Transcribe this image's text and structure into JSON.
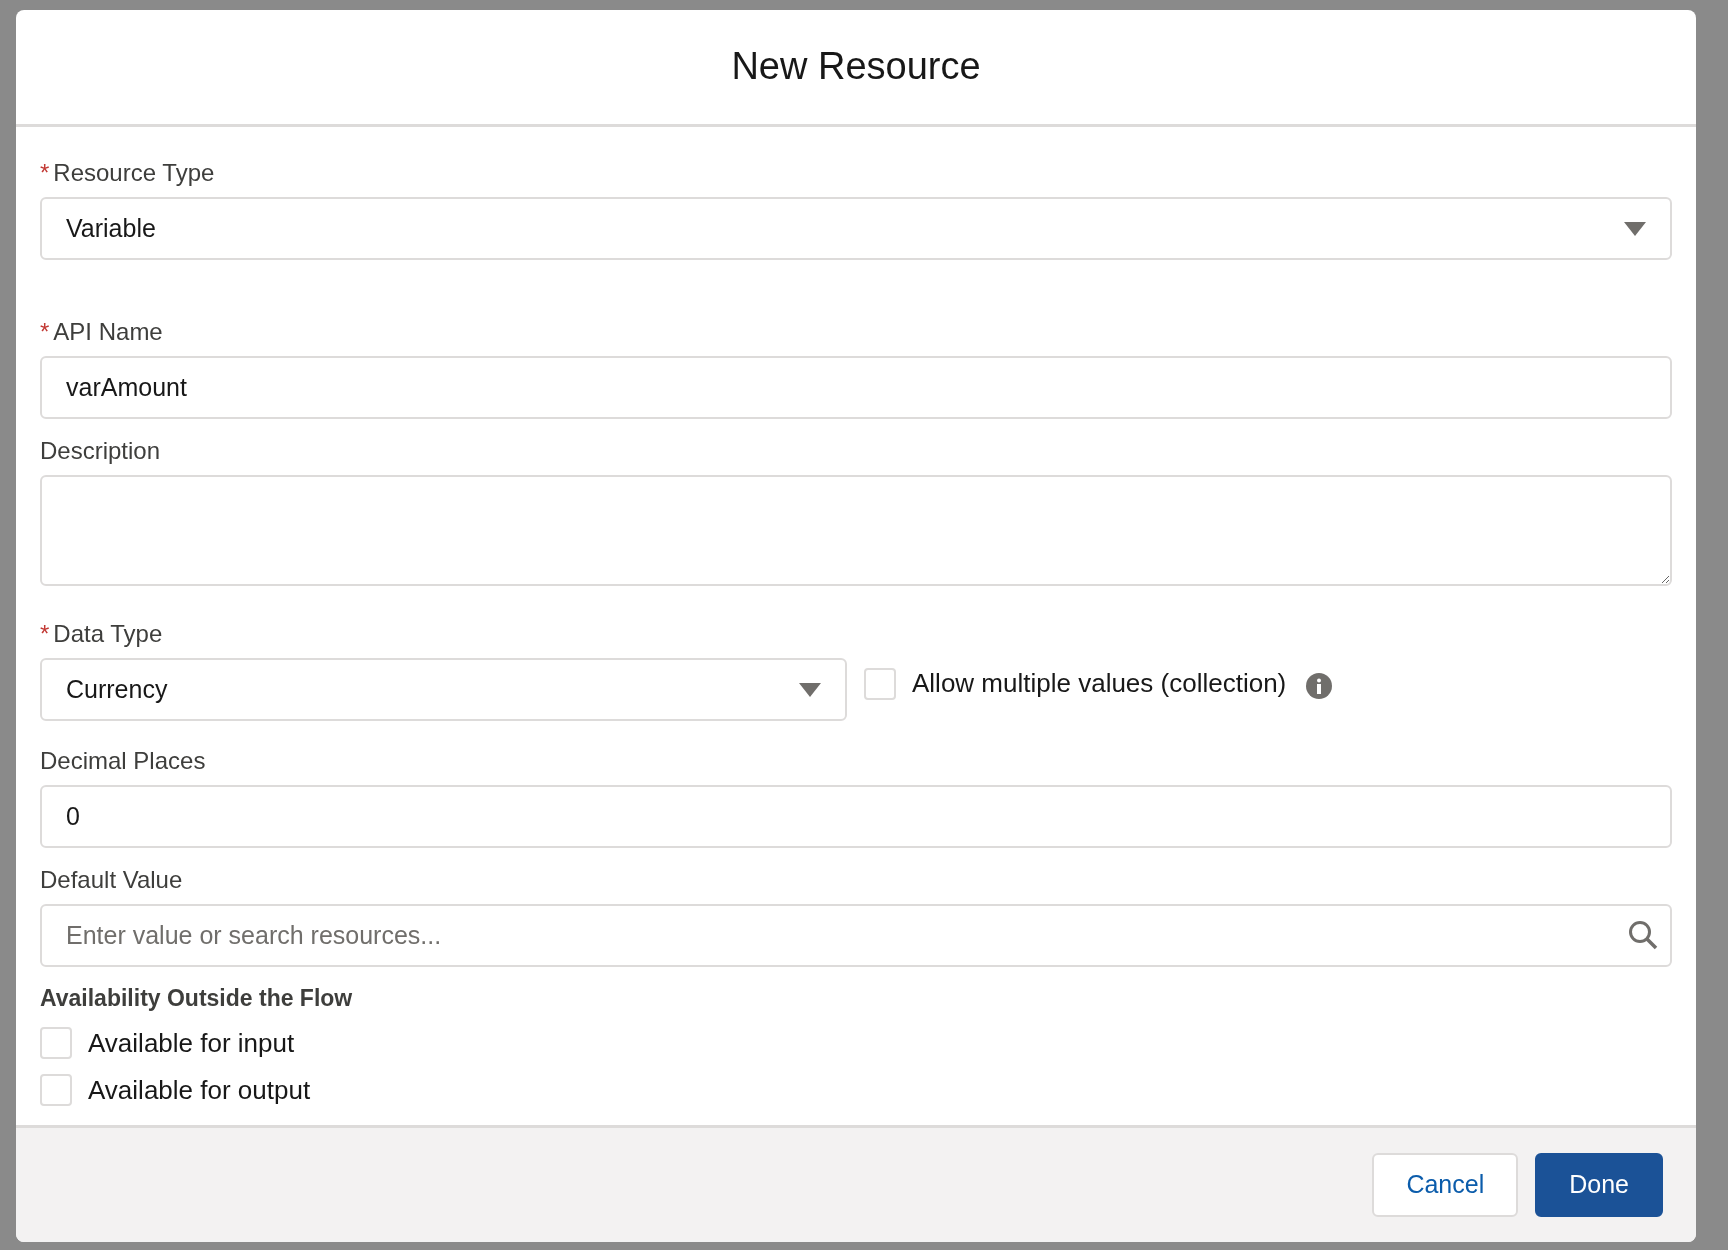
{
  "dialog": {
    "title": "New Resource"
  },
  "fields": [
    {
      "kind": "select",
      "label": "Resource Type",
      "required_mark": "*",
      "value": "Variable"
    },
    {
      "kind": "text",
      "label": "API Name",
      "required_mark": "*",
      "value": "varAmount"
    },
    {
      "kind": "textarea",
      "label": "Description"
    },
    {
      "kind": "datatype",
      "label": "Data Type",
      "required_mark": "*",
      "value": "Currency",
      "collection": {
        "label": "Allow multiple values (collection)",
        "checked": false
      }
    },
    {
      "kind": "text",
      "label": "Decimal Places",
      "value": "0"
    },
    {
      "kind": "search",
      "label": "Default Value",
      "placeholder": "Enter value or search resources..."
    }
  ],
  "availability": {
    "heading": "Availability Outside the Flow",
    "options": [
      {
        "label": "Available for input",
        "checked": false
      },
      {
        "label": "Available for output",
        "checked": false
      }
    ]
  },
  "buttons": [
    {
      "label": "Cancel",
      "kind": "neutral"
    },
    {
      "label": "Done",
      "kind": "brand"
    }
  ]
}
